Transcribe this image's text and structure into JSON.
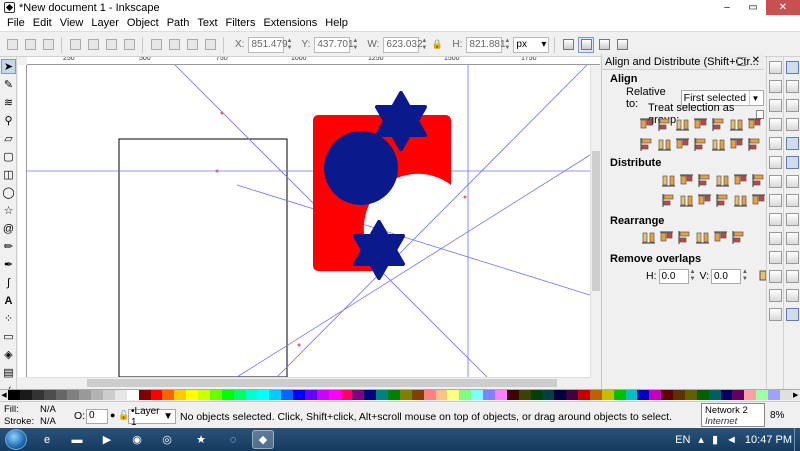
{
  "window": {
    "title": "*New document 1 - Inkscape",
    "controls": {
      "minimize": "–",
      "maximize": "▭",
      "close": "✕"
    }
  },
  "menu": [
    "File",
    "Edit",
    "View",
    "Layer",
    "Object",
    "Path",
    "Text",
    "Filters",
    "Extensions",
    "Help"
  ],
  "toolcontrols": {
    "x_label": "X:",
    "x_value": "851.479",
    "y_label": "Y:",
    "y_value": "437.701",
    "w_label": "W:",
    "w_value": "623.032",
    "h_label": "H:",
    "h_value": "821.881",
    "unit": "px"
  },
  "ruler": {
    "marks": [
      "250",
      "500",
      "750",
      "1000",
      "1250",
      "1500",
      "1750"
    ]
  },
  "dock": {
    "title": "Align and Distribute (Shift+Ctr...",
    "align_heading": "Align",
    "relative_label": "Relative to:",
    "relative_value": "First selected",
    "treat_label": "Treat selection as group:",
    "treat_checked": false,
    "distribute_heading": "Distribute",
    "rearrange_heading": "Rearrange",
    "overlaps_heading": "Remove overlaps",
    "h_label": "H:",
    "h_value": "0.0",
    "v_label": "V:",
    "v_value": "0.0"
  },
  "canvas": {
    "colors": {
      "rect": "#ff0000",
      "circle": "#0a1a8c",
      "star": "#0a1a8c",
      "guide": "#7070ff"
    }
  },
  "palette": [
    "#000000",
    "#1a1a1a",
    "#333333",
    "#4d4d4d",
    "#666666",
    "#808080",
    "#999999",
    "#b3b3b3",
    "#cccccc",
    "#e6e6e6",
    "#ffffff",
    "#800000",
    "#ff0000",
    "#ff6600",
    "#ffcc00",
    "#ffff00",
    "#ccff00",
    "#66ff00",
    "#00ff00",
    "#00ff66",
    "#00ffcc",
    "#00ffff",
    "#00ccff",
    "#0066ff",
    "#0000ff",
    "#6600ff",
    "#cc00ff",
    "#ff00ff",
    "#ff0066",
    "#800080",
    "#000080",
    "#008080",
    "#008000",
    "#808000",
    "#804000",
    "#ff8080",
    "#ffc080",
    "#ffff80",
    "#80ff80",
    "#80ffff",
    "#8080ff",
    "#ff80ff",
    "#400000",
    "#404000",
    "#004000",
    "#004040",
    "#000040",
    "#400040",
    "#c00000",
    "#c06000",
    "#c0c000",
    "#00c000",
    "#00c0c0",
    "#0000c0",
    "#c000c0",
    "#600000",
    "#603000",
    "#606000",
    "#006000",
    "#006060",
    "#000060",
    "#600060",
    "#ffa0a0",
    "#a0ffa0",
    "#a0a0ff",
    "#e0e0e0"
  ],
  "status": {
    "fill_label": "Fill:",
    "fill_value": "N/A",
    "stroke_label": "Stroke:",
    "stroke_value": "N/A",
    "opacity_label": "O:",
    "opacity_value": "0",
    "layer": "•Layer 1",
    "message": "No objects selected. Click, Shift+click, Alt+scroll mouse on top of objects, or drag around objects to select.",
    "zoom_value": "8%"
  },
  "tooltip": {
    "line1": "Network 2",
    "line2": "Internet access"
  },
  "taskbar": {
    "language": "EN",
    "clock": "10:47 PM"
  }
}
